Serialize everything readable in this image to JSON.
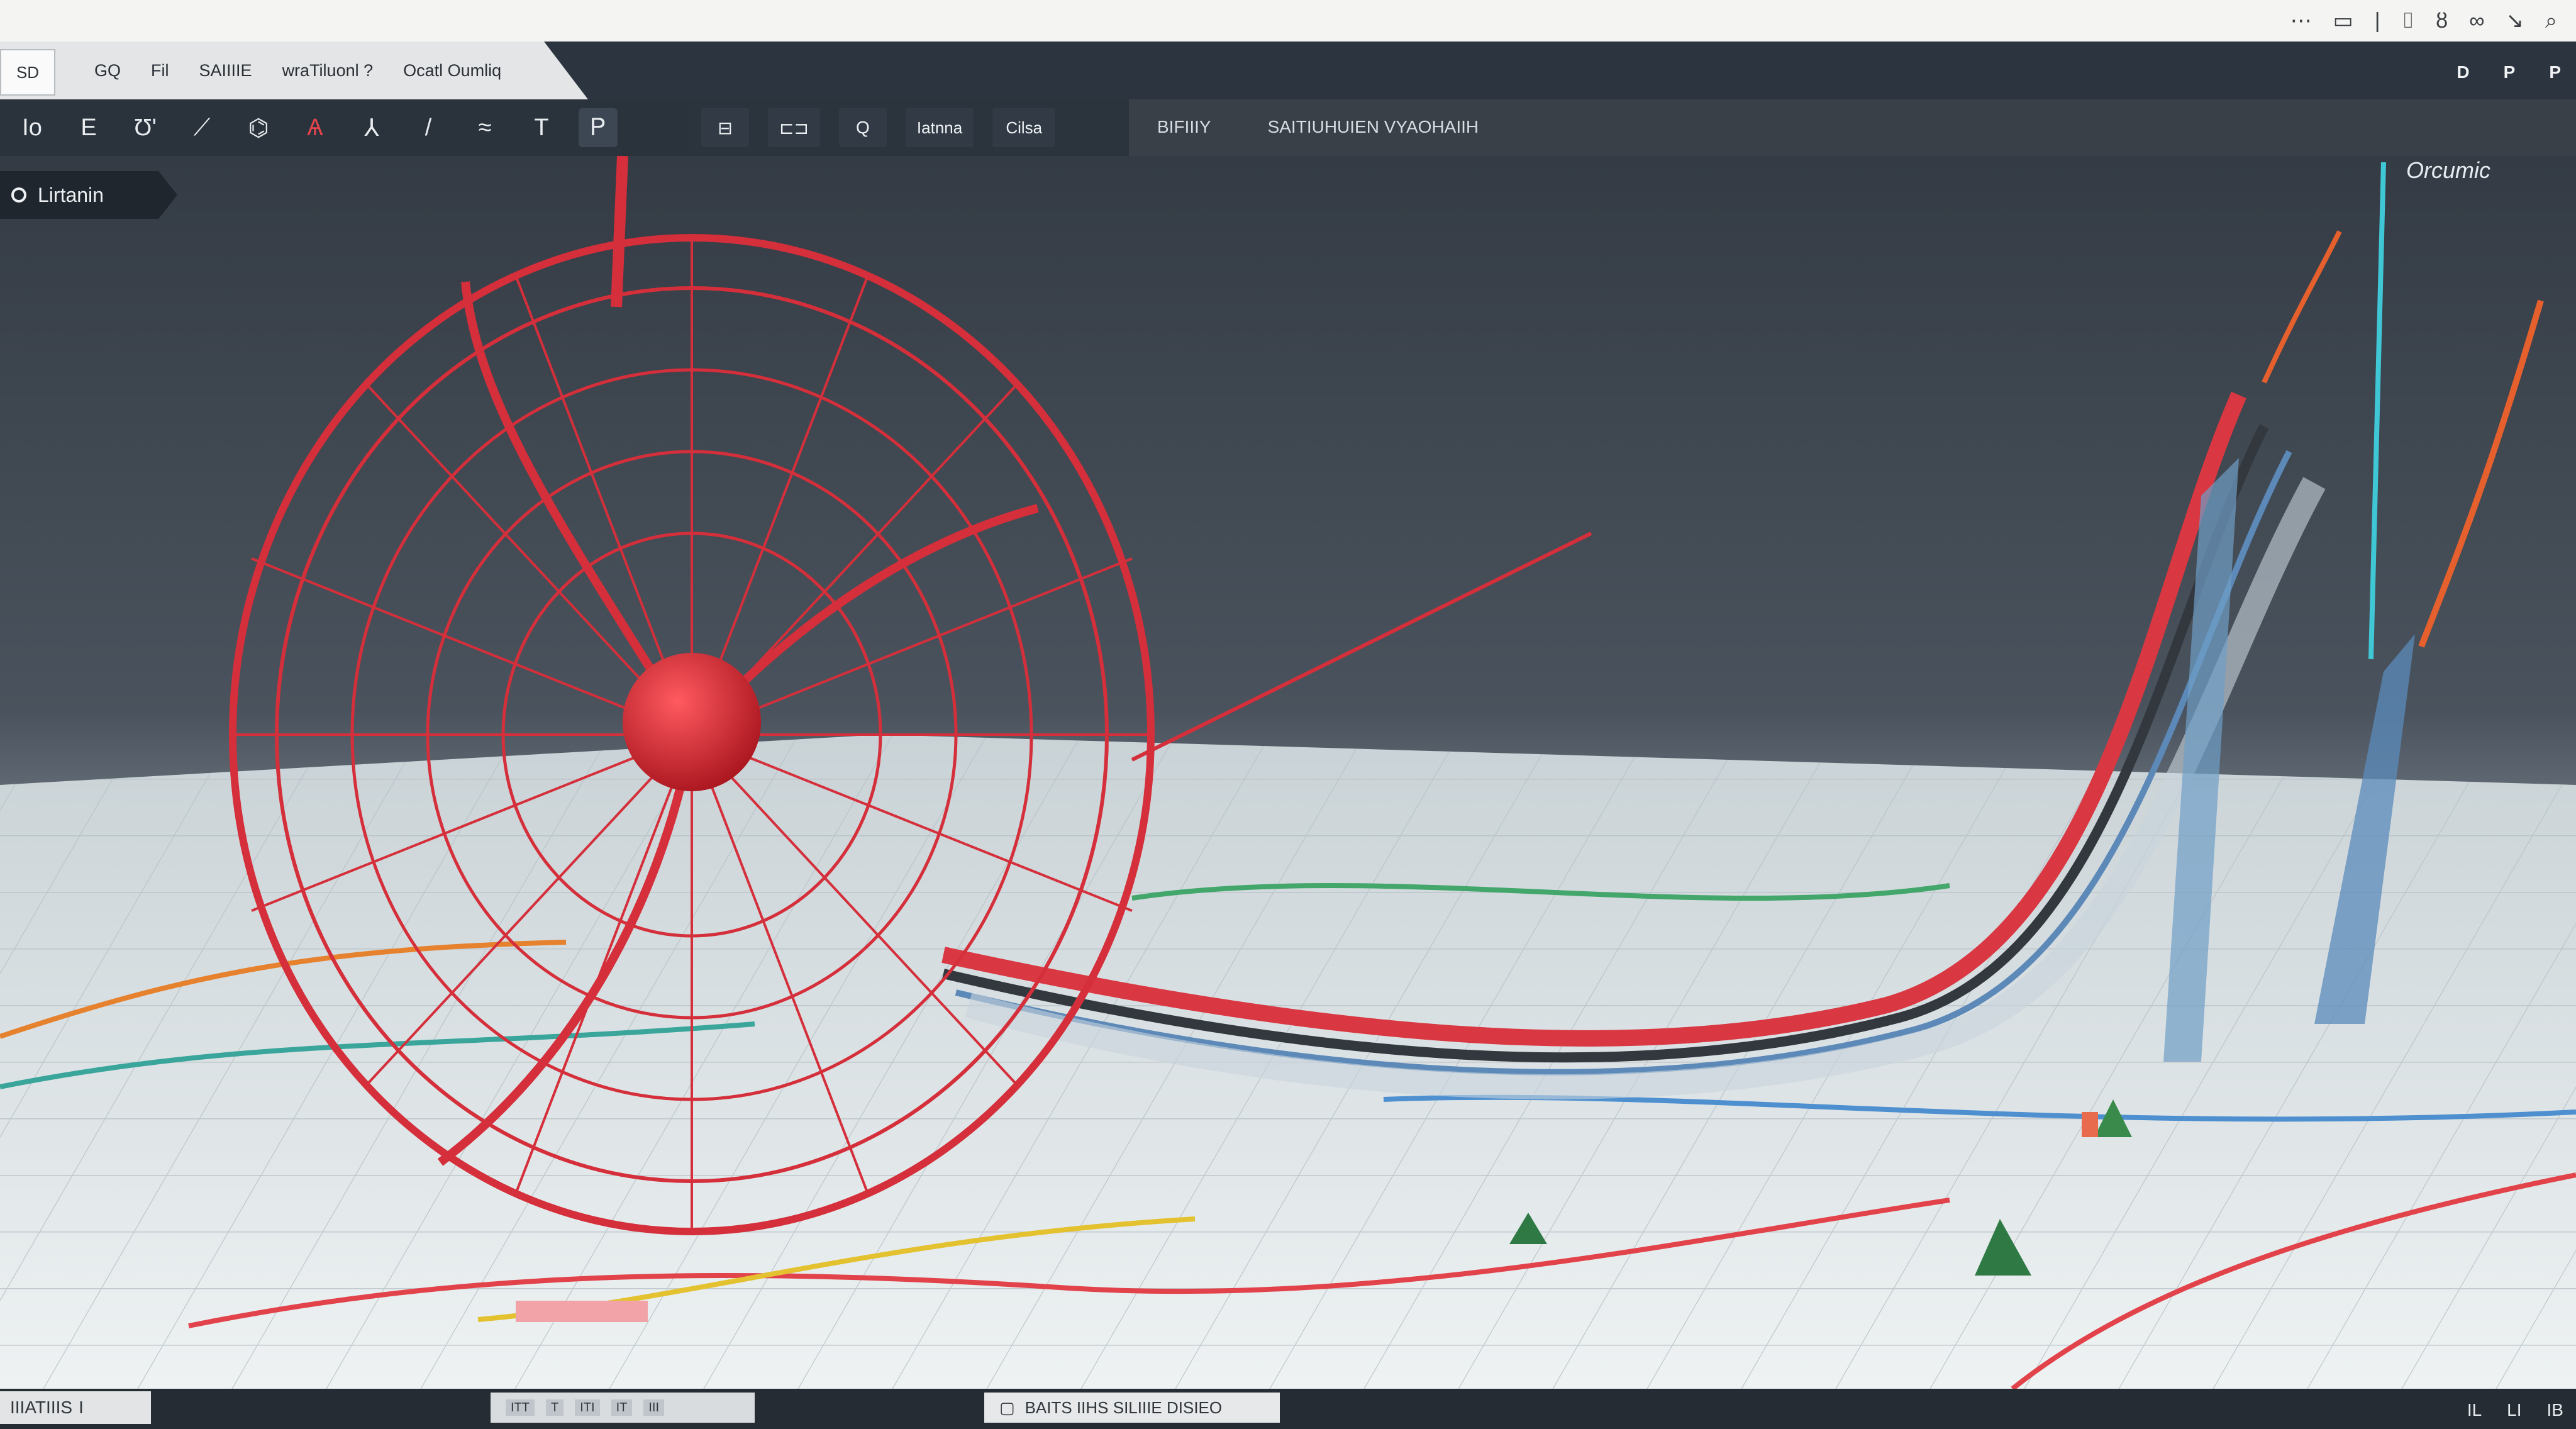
{
  "system_bar": {
    "icons": [
      "dots-icon",
      "rectangle-icon",
      "bar-icon",
      "tag-icon",
      "sigma-icon",
      "link-icon",
      "arrow-icon",
      "search-icon"
    ]
  },
  "app": {
    "badge": "SD"
  },
  "menu": {
    "items": [
      "GQ",
      "Fil",
      "SAIIIIE",
      "wraTiluonl ?",
      "Ocatl Oumliq"
    ]
  },
  "menubar_right": [
    "D",
    "P",
    "P"
  ],
  "toolbar": {
    "tools": [
      {
        "name": "text-tool",
        "glyph": "Io"
      },
      {
        "name": "grid-tool",
        "glyph": "E"
      },
      {
        "name": "brush-tool",
        "glyph": "Ʊ'"
      },
      {
        "name": "fill-tool",
        "glyph": "⟋"
      },
      {
        "name": "shape-tool",
        "glyph": "⌬"
      },
      {
        "name": "mark-tool",
        "glyph": "Ѧ"
      },
      {
        "name": "node-tool",
        "glyph": "⅄"
      },
      {
        "name": "pen-tool",
        "glyph": "/"
      },
      {
        "name": "curve-tool",
        "glyph": "≈"
      },
      {
        "name": "pin-tool",
        "glyph": "T"
      },
      {
        "name": "select-tool",
        "glyph": "Ꮲ"
      }
    ],
    "buttons": [
      {
        "name": "layout-button",
        "label": "⊟"
      },
      {
        "name": "grid-button",
        "label": "⊏⊐"
      },
      {
        "name": "search-button",
        "label": "Q"
      },
      {
        "name": "view-button",
        "label": "Iatnna"
      },
      {
        "name": "close-button",
        "label": "Cilsa"
      }
    ]
  },
  "breadcrumb": [
    "BIFIIIY",
    "SAITIUHUIEN VYAOHAIIH"
  ],
  "layer": {
    "label": "Lirtanin"
  },
  "chart_label": "Orcumic",
  "status": {
    "left": "IIIATIIIS",
    "left_badge": "I",
    "mid_cells": [
      "ITT",
      "T",
      "ITI",
      "IT",
      "III"
    ],
    "mid2_label": "BAITS IIHS SILIIIE DISIEO",
    "right": [
      "IL",
      "LI",
      "IB"
    ]
  },
  "colors": {
    "accent_red": "#d93842",
    "accent_cyan": "#3fc7d6",
    "accent_orange": "#e6602e",
    "accent_blue": "#2d7fc1",
    "menubar": "#2c3440"
  }
}
